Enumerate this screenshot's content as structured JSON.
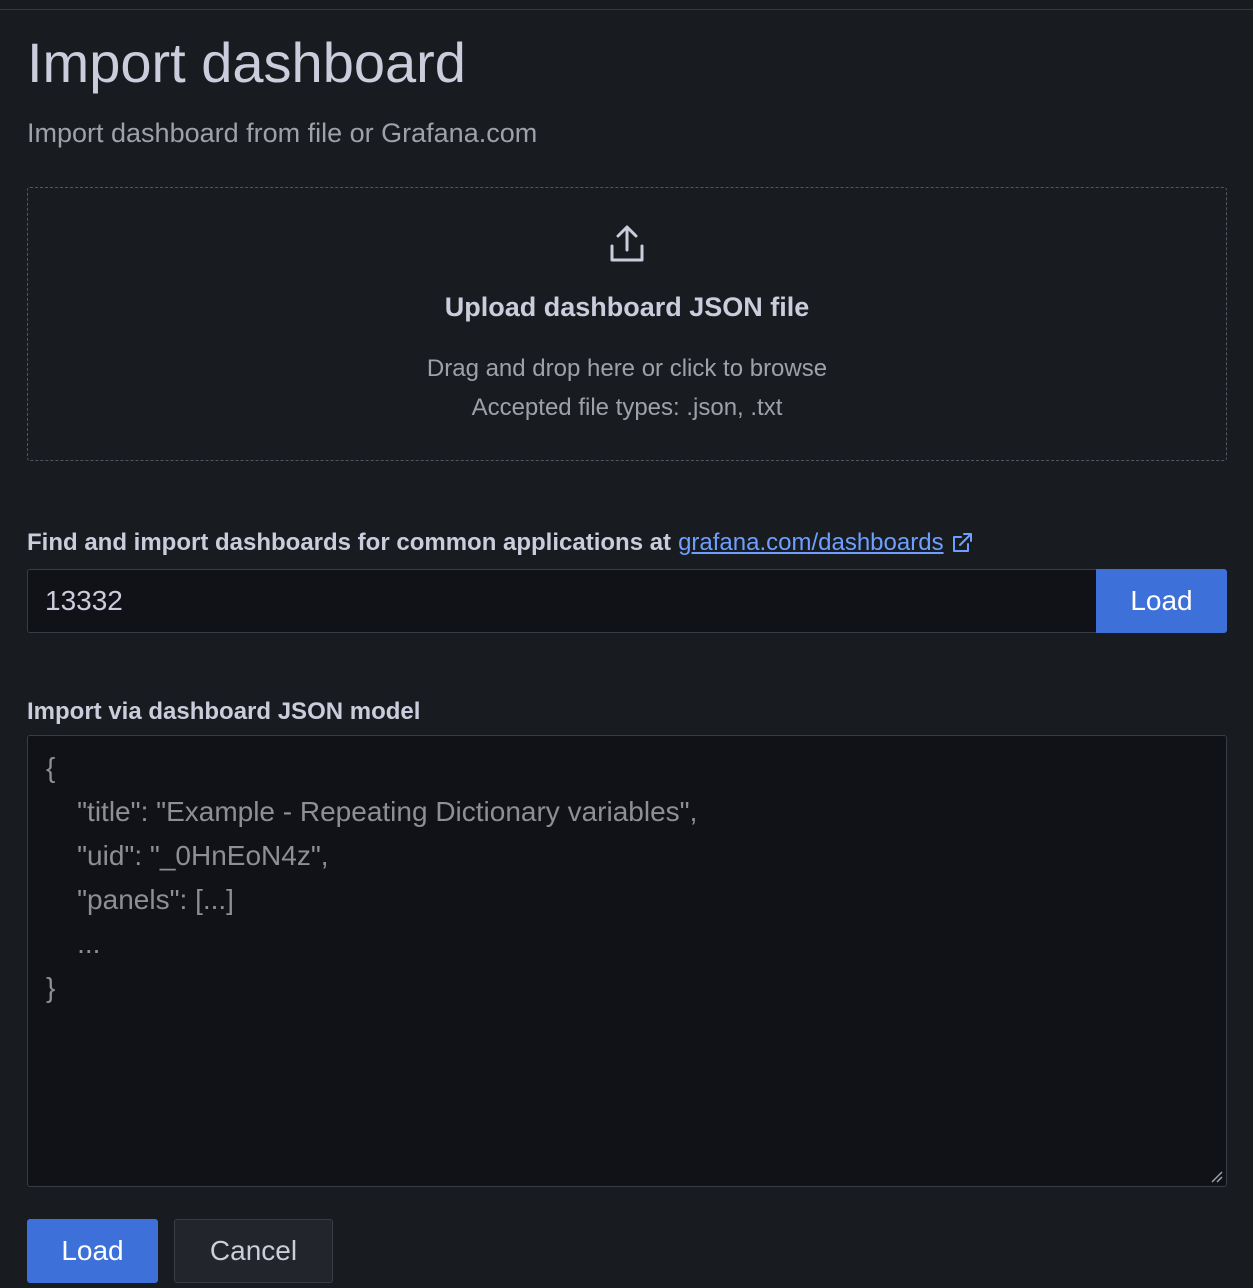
{
  "page": {
    "title": "Import dashboard",
    "subtitle": "Import dashboard from file or Grafana.com"
  },
  "upload": {
    "icon": "upload-icon",
    "title": "Upload dashboard JSON file",
    "hint": "Drag and drop here or click to browse",
    "accepted_types": "Accepted file types: .json, .txt"
  },
  "grafana_com": {
    "label": "Find and import dashboards for common applications at",
    "link_text": "grafana.com/dashboards",
    "link_icon": "external-link-icon",
    "input_value": "13332",
    "load_label": "Load"
  },
  "json_model": {
    "label": "Import via dashboard JSON model",
    "placeholder": "{\n    \"title\": \"Example - Repeating Dictionary variables\",\n    \"uid\": \"_0HnEoN4z\",\n    \"panels\": [...]\n    ...\n}"
  },
  "footer": {
    "load_label": "Load",
    "cancel_label": "Cancel"
  },
  "colors": {
    "background": "#181b1f",
    "primary": "#3d71d9",
    "link": "#6e9fff",
    "text": "#ccccdc",
    "secondary_text": "#9fa1a8"
  }
}
